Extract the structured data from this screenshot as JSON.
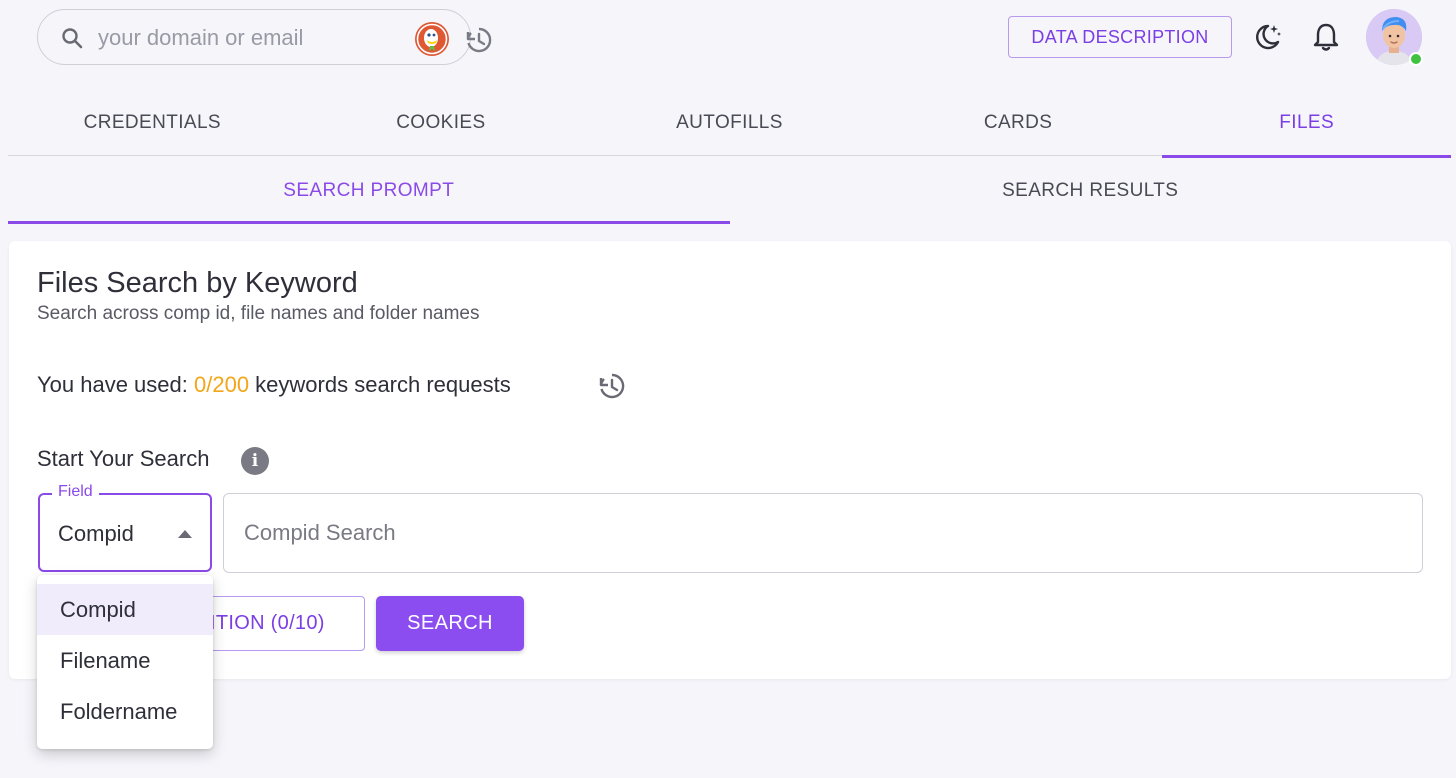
{
  "topbar": {
    "search_placeholder": "your domain or email",
    "data_description_label": "DATA DESCRIPTION",
    "icons": [
      "search-icon",
      "duckduckgo-icon",
      "history-icon",
      "moon-star-icon",
      "bell-icon",
      "avatar"
    ]
  },
  "main_tabs": [
    {
      "label": "CREDENTIALS",
      "active": false
    },
    {
      "label": "COOKIES",
      "active": false
    },
    {
      "label": "AUTOFILLS",
      "active": false
    },
    {
      "label": "CARDS",
      "active": false
    },
    {
      "label": "FILES",
      "active": true
    }
  ],
  "sub_tabs": [
    {
      "label": "SEARCH PROMPT",
      "active": true
    },
    {
      "label": "SEARCH RESULTS",
      "active": false
    }
  ],
  "card": {
    "title": "Files Search by Keyword",
    "subtitle": "Search across comp id, file names and folder names",
    "usage": {
      "prefix": "You have used: ",
      "count": "0/200",
      "suffix": " keywords search requests"
    },
    "start_label": "Start Your Search",
    "info_glyph": "i",
    "field": {
      "legend": "Field",
      "value": "Compid"
    },
    "search_placeholder": "Compid Search",
    "add_condition_label": "ITION (0/10)",
    "search_button_label": "SEARCH"
  },
  "dropdown": {
    "options": [
      {
        "label": "Compid",
        "selected": true
      },
      {
        "label": "Filename",
        "selected": false
      },
      {
        "label": "Foldername",
        "selected": false
      }
    ]
  },
  "colors": {
    "accent": "#8a4ae8",
    "usage_count": "#f2a618",
    "online_status": "#3fc23f"
  }
}
